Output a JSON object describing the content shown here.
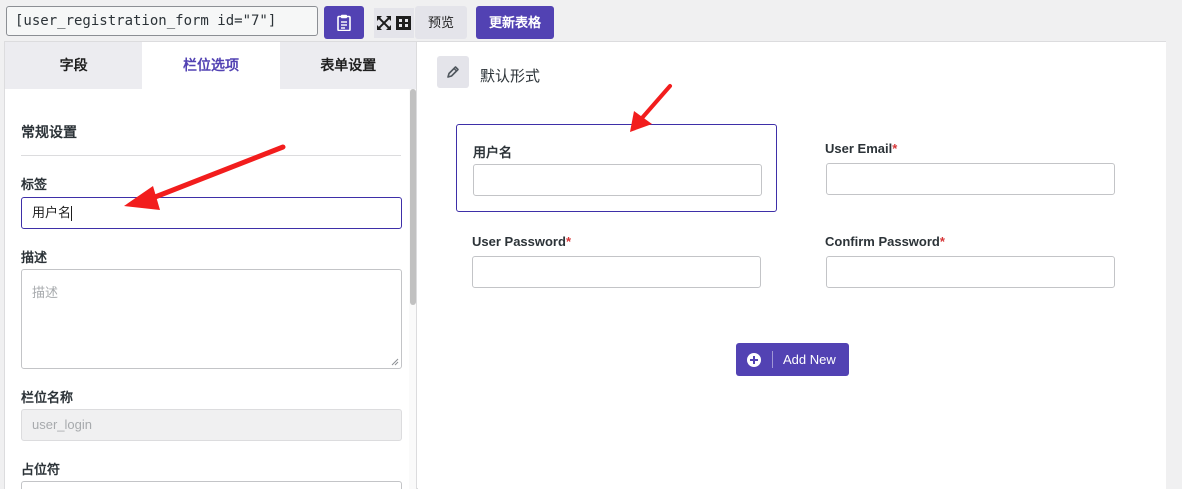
{
  "toolbar": {
    "shortcode": "[user_registration_form id=\"7\"]",
    "copy_icon": "clipboard-icon",
    "fullscreen_icon": "fullscreen-icon",
    "preview_label": "预览",
    "update_label": "更新表格"
  },
  "tabs": [
    {
      "label": "字段"
    },
    {
      "label": "栏位选项",
      "active": true
    },
    {
      "label": "表单设置"
    }
  ],
  "settings": {
    "section_title": "常规设置",
    "label_label": "标签",
    "label_value": "用户名",
    "description_label": "描述",
    "description_placeholder": "描述",
    "field_name_label": "栏位名称",
    "field_name_value": "user_login",
    "placeholder_label": "占位符"
  },
  "canvas": {
    "row_title": "默认形式",
    "edit_icon": "pencil-icon",
    "fields": [
      {
        "label": "用户名",
        "required": false,
        "selected": true
      },
      {
        "label": "User Email",
        "required": true
      },
      {
        "label": "User Password",
        "required": true
      },
      {
        "label": "Confirm Password",
        "required": true
      }
    ],
    "required_mark": "*",
    "add_new_label": "Add New"
  },
  "colors": {
    "accent": "#5242b3",
    "required": "#d63638",
    "annotation_arrow": "#f21d1d"
  }
}
